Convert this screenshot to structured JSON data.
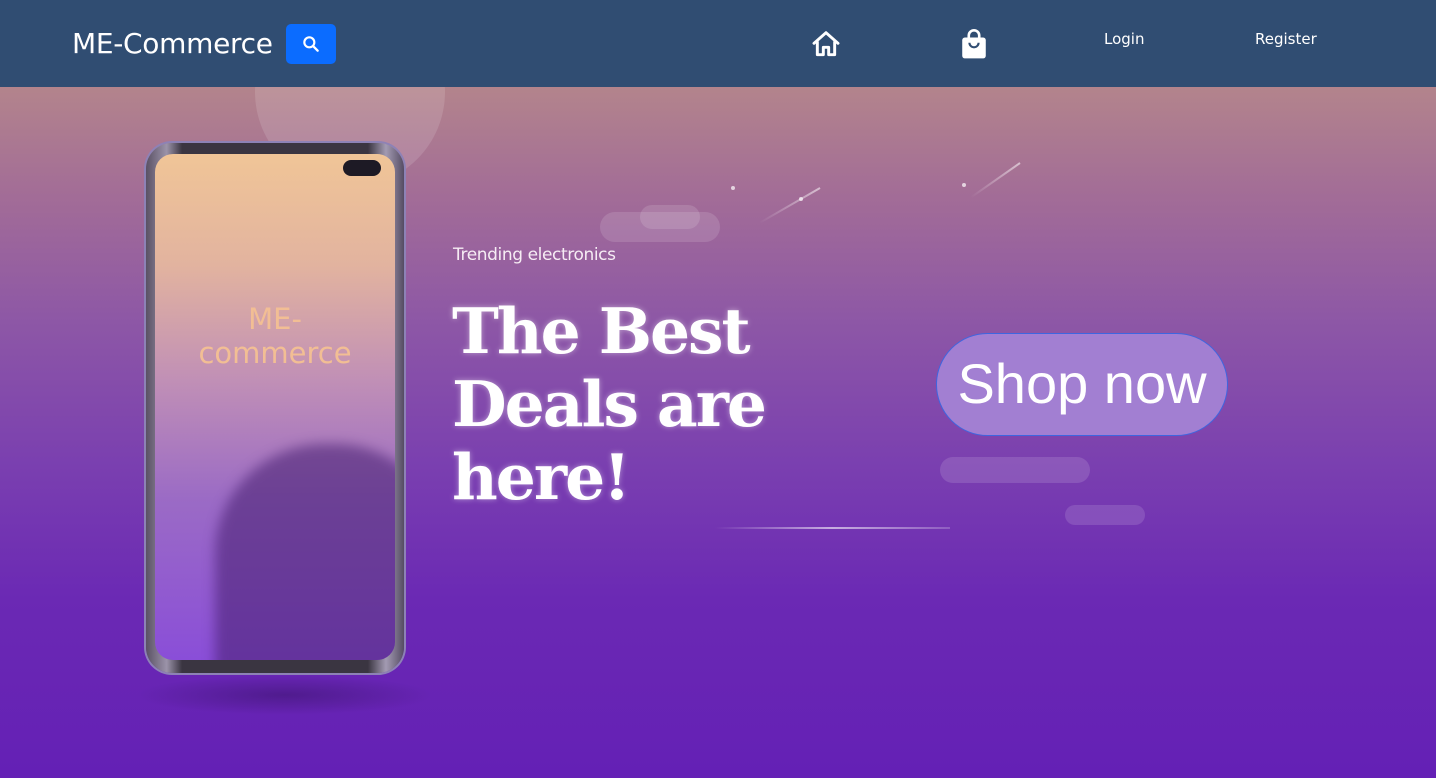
{
  "navbar": {
    "brand": "ME-Commerce",
    "search_icon": "search-icon",
    "home_icon": "home-icon",
    "bag_icon": "shopping-bag-icon",
    "login_label": "Login",
    "register_label": "Register",
    "background_color": "#304d72",
    "search_button_color": "#0b6cff"
  },
  "hero": {
    "phone_screen_text": "ME-\ncommerce",
    "tagline": "Trending electronics",
    "headline": "The Best Deals are here!",
    "cta_label": "Shop now",
    "cta_color": "#a27fd2"
  }
}
